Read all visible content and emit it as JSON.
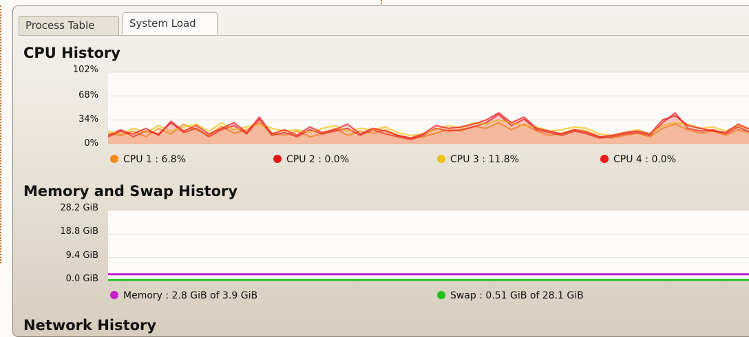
{
  "tabs": [
    {
      "label": "Process Table"
    },
    {
      "label": "System Load"
    }
  ],
  "cpu": {
    "title": "CPU History",
    "y_ticks": [
      "102%",
      "68%",
      "34%",
      "0%"
    ],
    "legend": [
      {
        "label": "CPU 1 : 6.8%",
        "color": "#f5891f"
      },
      {
        "label": "CPU 2 : 0.0%",
        "color": "#e21919"
      },
      {
        "label": "CPU 3 : 11.8%",
        "color": "#ecc51b"
      },
      {
        "label": "CPU 4 : 0.0%",
        "color": "#ef1616"
      }
    ]
  },
  "memory": {
    "title": "Memory and Swap History",
    "y_ticks": [
      "28.2 GiB",
      "18.8 GiB",
      "9.4 GiB",
      "0.0 GiB"
    ],
    "legend": [
      {
        "label": "Memory : 2.8 GiB of 3.9 GiB",
        "color": "#c21ec9"
      },
      {
        "label": "Swap : 0.51 GiB of 28.1 GiB",
        "color": "#22c21e"
      }
    ]
  },
  "network": {
    "title": "Network History"
  },
  "chart_data": [
    {
      "type": "line",
      "title": "CPU History",
      "ylim": [
        0,
        102
      ],
      "y_ticks": [
        0,
        34,
        68,
        102
      ],
      "series": [
        {
          "name": "CPU 1",
          "values": [
            15,
            12,
            18,
            10,
            22,
            14,
            28,
            20,
            12,
            25,
            15,
            20,
            30,
            15,
            12,
            18,
            10,
            14,
            22,
            12,
            18,
            15,
            20,
            12,
            8,
            10,
            15,
            20,
            18,
            25,
            22,
            30,
            20,
            28,
            18,
            12,
            15,
            20,
            18,
            10,
            8,
            12,
            15,
            10,
            22,
            28,
            20,
            15,
            18,
            12,
            20,
            15,
            10
          ]
        },
        {
          "name": "CPU 2",
          "values": [
            12,
            20,
            10,
            18,
            14,
            30,
            16,
            22,
            10,
            20,
            26,
            14,
            35,
            12,
            16,
            10,
            20,
            14,
            18,
            22,
            12,
            20,
            14,
            10,
            6,
            12,
            22,
            18,
            20,
            24,
            30,
            42,
            26,
            35,
            20,
            16,
            12,
            18,
            14,
            8,
            10,
            14,
            16,
            12,
            30,
            44,
            22,
            18,
            20,
            14,
            24,
            16,
            18
          ]
        },
        {
          "name": "CPU 3",
          "values": [
            18,
            14,
            22,
            16,
            26,
            18,
            24,
            28,
            18,
            30,
            20,
            24,
            28,
            22,
            18,
            20,
            16,
            22,
            26,
            18,
            22,
            20,
            24,
            16,
            12,
            14,
            20,
            26,
            22,
            30,
            28,
            34,
            30,
            26,
            24,
            18,
            20,
            24,
            22,
            14,
            12,
            16,
            20,
            14,
            26,
            30,
            28,
            22,
            24,
            18,
            26,
            20,
            22
          ]
        },
        {
          "name": "CPU 4",
          "values": [
            10,
            18,
            14,
            22,
            12,
            32,
            18,
            26,
            14,
            22,
            30,
            16,
            38,
            14,
            20,
            12,
            24,
            16,
            20,
            28,
            14,
            22,
            18,
            12,
            8,
            14,
            26,
            22,
            24,
            28,
            34,
            44,
            30,
            38,
            22,
            18,
            14,
            20,
            16,
            10,
            12,
            16,
            18,
            14,
            34,
            40,
            26,
            22,
            18,
            16,
            28,
            20,
            16
          ]
        }
      ]
    },
    {
      "type": "line",
      "title": "Memory and Swap History",
      "ylim": [
        0,
        28.2
      ],
      "y_ticks": [
        0.0,
        9.4,
        18.8,
        28.2
      ],
      "series": [
        {
          "name": "Memory",
          "values": [
            2.8,
            2.8
          ]
        },
        {
          "name": "Swap",
          "values": [
            0.51,
            0.51
          ]
        }
      ]
    }
  ]
}
